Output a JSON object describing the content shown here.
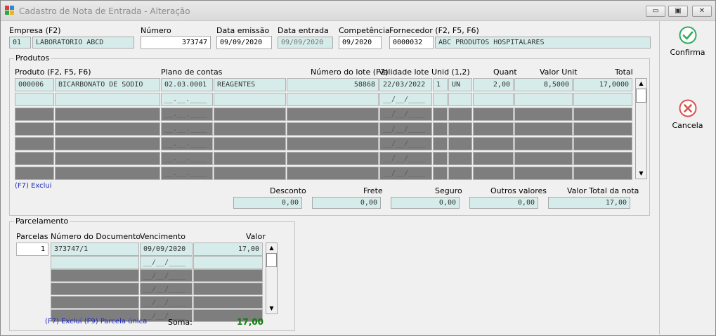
{
  "window": {
    "title": "Cadastro de Nota de Entrada - Alteração",
    "buttons": {
      "minimize": "▭",
      "restore": "▣",
      "close": "✕"
    }
  },
  "header": {
    "empresa": {
      "label": "Empresa (F2)",
      "code": "01",
      "name": "LABORATORIO ABCD"
    },
    "numero": {
      "label": "Número",
      "value": "373747"
    },
    "data_emissao": {
      "label": "Data emissão",
      "value": "09/09/2020"
    },
    "data_entrada": {
      "label": "Data entrada",
      "value": "09/09/2020"
    },
    "competencia": {
      "label": "Competência",
      "value": "09/2020"
    },
    "fornecedor": {
      "label": "Fornecedor (F2, F5, F6)",
      "code": "0000032",
      "name": "ABC PRODUTOS HOSPITALARES"
    }
  },
  "produtos": {
    "title": "Produtos",
    "columns": {
      "produto": "Produto (F2, F5, F6)",
      "plano": "Plano de contas",
      "lote": "Número do lote (F2)",
      "validade": "Validade lote",
      "unid": "Unid (1,2)",
      "quant": "Quant",
      "valor_unit": "Valor Unit",
      "total": "Total"
    },
    "rows": [
      {
        "codigo": "000006",
        "descricao": "BICARBONATO DE SODIO",
        "plano_codigo": "02.03.0001",
        "plano_desc": "REAGENTES",
        "lote": "58868",
        "validade": "22/03/2022",
        "unid_num": "1",
        "unid": "UN",
        "quant": "2,00",
        "valor_unit": "8,5000",
        "total": "17,0000"
      }
    ],
    "mask_plano": "__.__.____",
    "mask_data": "__/__/____",
    "exclui_hint": "(F7) Exclui"
  },
  "totais": {
    "desconto": {
      "label": "Desconto",
      "value": "0,00"
    },
    "frete": {
      "label": "Frete",
      "value": "0,00"
    },
    "seguro": {
      "label": "Seguro",
      "value": "0,00"
    },
    "outros": {
      "label": "Outros valores",
      "value": "0,00"
    },
    "valor_total": {
      "label": "Valor Total da nota",
      "value": "17,00"
    }
  },
  "parcelamento": {
    "title": "Parcelamento",
    "columns": {
      "parcelas": "Parcelas",
      "documento": "Número do Documento",
      "vencimento": "Vencimento",
      "valor": "Valor"
    },
    "parcelas_count": "1",
    "rows": [
      {
        "documento": "373747/1",
        "vencimento": "09/09/2020",
        "valor": "17,00"
      }
    ],
    "mask_data": "__/__/____",
    "hints": "(F7) Exclui  (F9) Parcela única",
    "soma_label": "Soma:",
    "soma_value": "17,00"
  },
  "actions": {
    "confirma": "Confirma",
    "cancela": "Cancela"
  },
  "colors": {
    "field_bg": "#d6ecea",
    "confirm": "#2fae5c",
    "cancel": "#d9534f",
    "soma": "#0b7f0b",
    "hint": "#1f2ab8"
  }
}
